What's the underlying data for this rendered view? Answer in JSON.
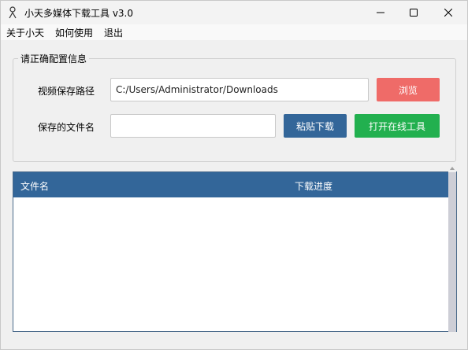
{
  "window": {
    "title": "小天多媒体下载工具 v3.0",
    "icon": "person-icon"
  },
  "menu": {
    "items": [
      "关于小天",
      "如何使用",
      "退出"
    ]
  },
  "config": {
    "legend": "请正确配置信息",
    "path_label": "视频保存路径",
    "path_value": "C:/Users/Administrator/Downloads",
    "name_label": "保存的文件名",
    "name_value": "",
    "browse_label": "浏览",
    "paste_label": "粘贴下载",
    "online_label": "打开在线工具"
  },
  "table": {
    "columns": [
      "文件名",
      "下载进度"
    ],
    "rows": []
  },
  "colors": {
    "browse": "#ef6b68",
    "paste": "#336699",
    "online": "#22b04f",
    "header": "#336699"
  }
}
